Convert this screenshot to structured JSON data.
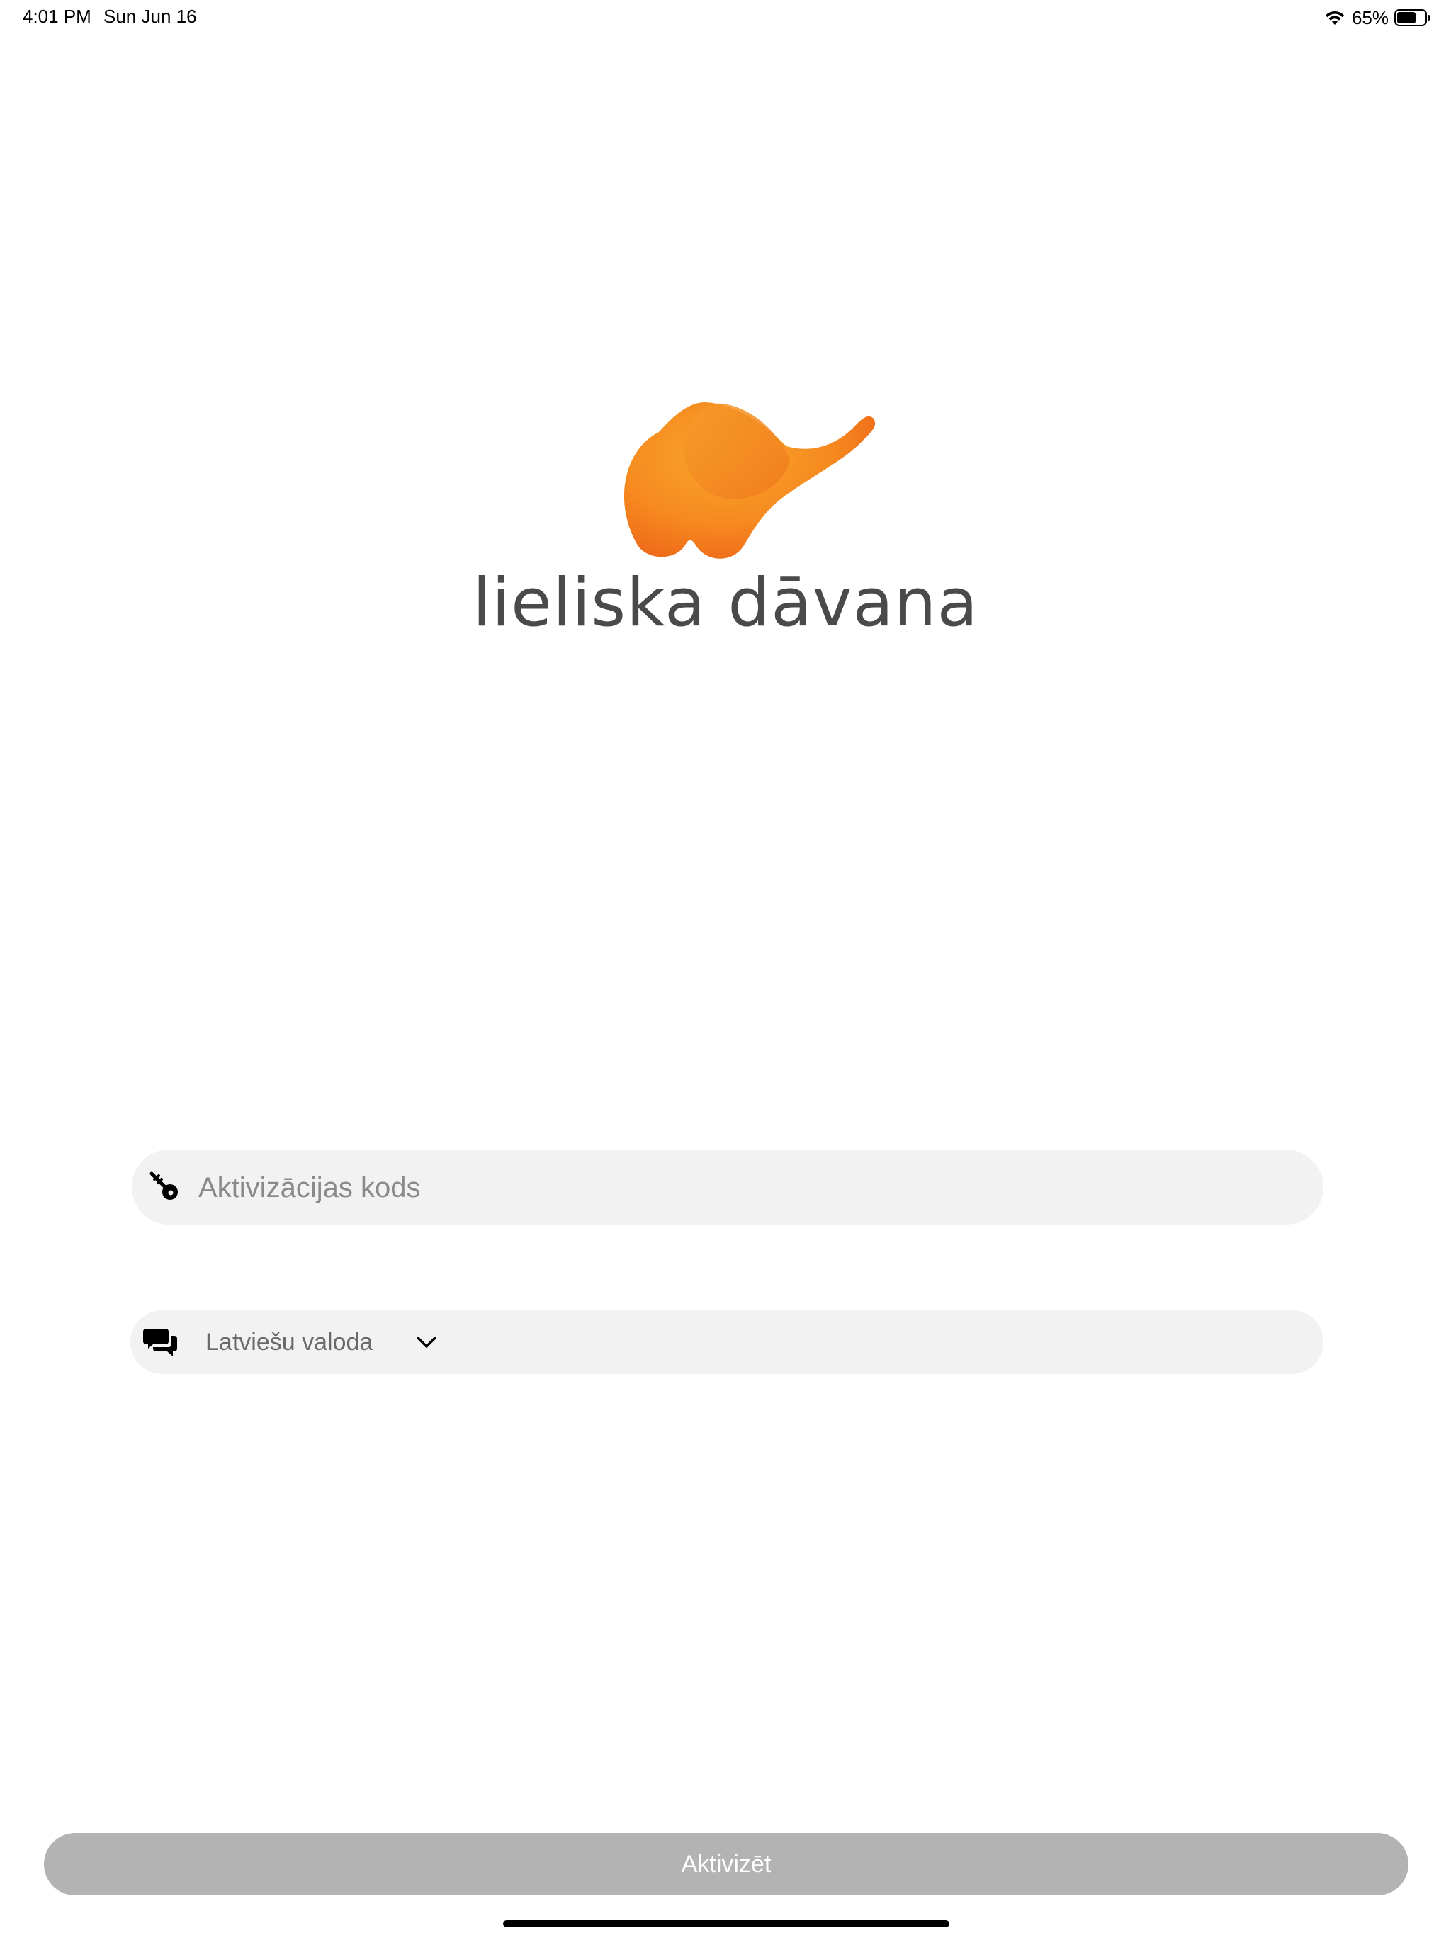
{
  "status_bar": {
    "time": "4:01 PM",
    "date": "Sun Jun 16",
    "battery_percent": "65%",
    "icons": [
      "wifi-icon",
      "battery-icon"
    ]
  },
  "brand": {
    "name": "lieliska dāvana",
    "logo_icon": "elephant-logo-icon",
    "logo_color": "#f7931e",
    "text_color": "#4a4a4a"
  },
  "form": {
    "code_input": {
      "placeholder": "Aktivizācijas kods",
      "value": "",
      "icon": "key-icon"
    },
    "language_select": {
      "selected": "Latviešu valoda",
      "icon": "chat-bubbles-icon",
      "dropdown_icon": "chevron-down-icon"
    },
    "field_background": "#f2f2f2"
  },
  "actions": {
    "activate_label": "Aktivizēt",
    "activate_color": "#b3b3b3"
  }
}
